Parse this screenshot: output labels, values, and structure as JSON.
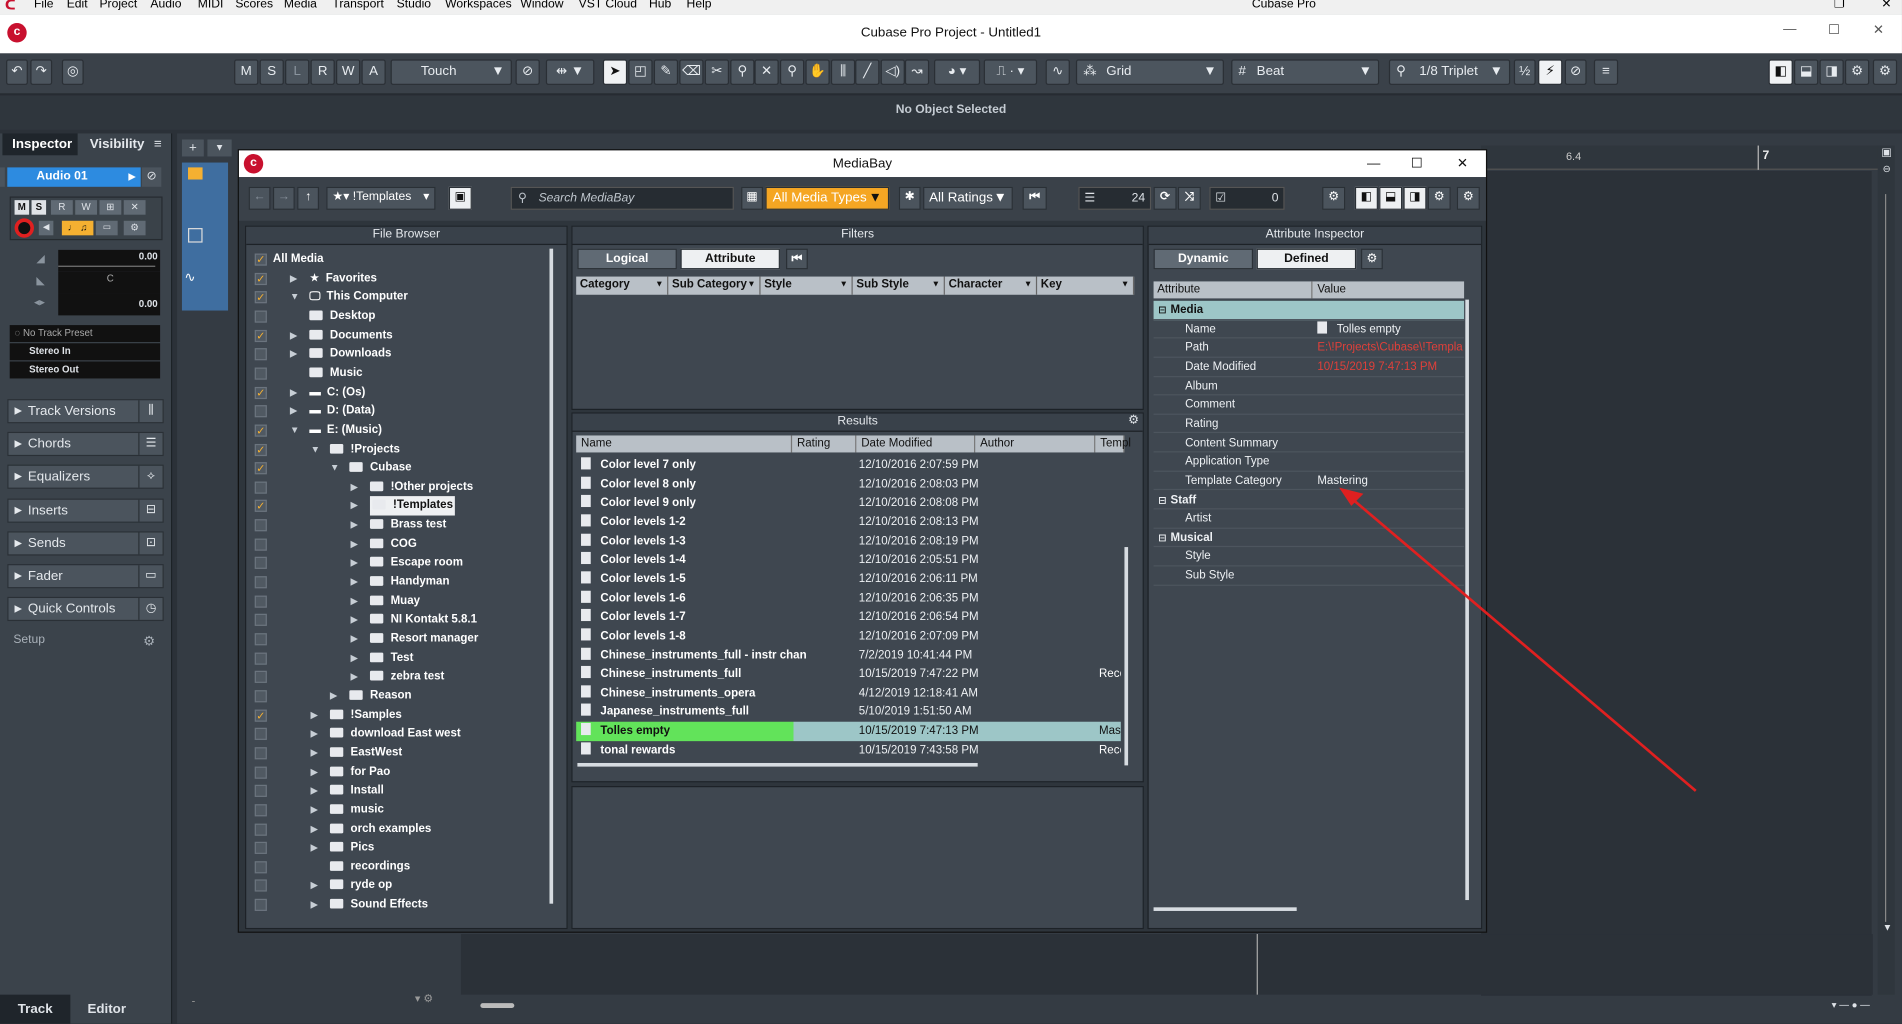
{
  "menu": {
    "items": [
      "File",
      "Edit",
      "Project",
      "Audio",
      "MIDI",
      "Scores",
      "Media",
      "Transport",
      "Studio",
      "Workspaces",
      "Window",
      "VST Cloud",
      "Hub",
      "Help"
    ],
    "app_name": "Cubase Pro"
  },
  "window": {
    "title": "Cubase Pro Project - Untitled1"
  },
  "toolbar": {
    "m": "M",
    "s": "S",
    "l": "L",
    "r": "R",
    "w": "W",
    "a": "A",
    "automation_mode": "Touch",
    "snap_type": "Grid",
    "grid_type": "Beat",
    "quantize": "1/8 Triplet"
  },
  "status": {
    "text": "No Object Selected"
  },
  "inspector": {
    "tab_inspector": "Inspector",
    "tab_visibility": "Visibility",
    "track_name": "Audio 01",
    "volume": "0.00",
    "pan": "C",
    "delay": "0.00",
    "track_preset": "No Track Preset",
    "input": "Stereo In",
    "output": "Stereo Out",
    "sections": [
      "Track Versions",
      "Chords",
      "Equalizers",
      "Inserts",
      "Sends",
      "Fader",
      "Quick Controls"
    ],
    "setup": "Setup",
    "bottom_track": "Track",
    "bottom_editor": "Editor"
  },
  "ruler": {
    "mark1": "6.4",
    "mark2": "7"
  },
  "mediabay": {
    "title": "MediaBay",
    "location": "!Templates",
    "search_placeholder": "Search MediaBay",
    "media_types": "All Media Types",
    "ratings": "All Ratings",
    "result_count": "24",
    "selected_count": "0",
    "file_browser": {
      "title": "File Browser",
      "items": [
        {
          "label": "All Media",
          "level": 0,
          "checked": true,
          "tri": "",
          "icon": ""
        },
        {
          "label": "Favorites",
          "level": 1,
          "checked": true,
          "tri": "▶",
          "icon": "star"
        },
        {
          "label": "This Computer",
          "level": 1,
          "checked": true,
          "tri": "▼",
          "icon": "pc"
        },
        {
          "label": "Desktop",
          "level": 2,
          "checked": false,
          "tri": "",
          "icon": "folder"
        },
        {
          "label": "Documents",
          "level": 2,
          "checked": true,
          "tri": "▶",
          "icon": "folder"
        },
        {
          "label": "Downloads",
          "level": 2,
          "checked": false,
          "tri": "▶",
          "icon": "folder"
        },
        {
          "label": "Music",
          "level": 2,
          "checked": false,
          "tri": "",
          "icon": "folder"
        },
        {
          "label": "C: (Os)",
          "level": 2,
          "checked": true,
          "tri": "▶",
          "icon": "drive"
        },
        {
          "label": "D: (Data)",
          "level": 2,
          "checked": false,
          "tri": "▶",
          "icon": "drive"
        },
        {
          "label": "E: (Music)",
          "level": 2,
          "checked": true,
          "tri": "▼",
          "icon": "drive"
        },
        {
          "label": "!Projects",
          "level": 3,
          "checked": true,
          "tri": "▼",
          "icon": "folder"
        },
        {
          "label": "Cubase",
          "level": 4,
          "checked": true,
          "tri": "▼",
          "icon": "folder"
        },
        {
          "label": "!Other projects",
          "level": 5,
          "checked": false,
          "tri": "▶",
          "icon": "folder"
        },
        {
          "label": "!Templates",
          "level": 5,
          "checked": true,
          "tri": "▶",
          "icon": "folder",
          "selected": true
        },
        {
          "label": "Brass test",
          "level": 5,
          "checked": false,
          "tri": "▶",
          "icon": "folder"
        },
        {
          "label": "COG",
          "level": 5,
          "checked": false,
          "tri": "▶",
          "icon": "folder"
        },
        {
          "label": "Escape room",
          "level": 5,
          "checked": false,
          "tri": "▶",
          "icon": "folder"
        },
        {
          "label": "Handyman",
          "level": 5,
          "checked": false,
          "tri": "▶",
          "icon": "folder"
        },
        {
          "label": "Muay",
          "level": 5,
          "checked": false,
          "tri": "▶",
          "icon": "folder"
        },
        {
          "label": "NI Kontakt 5.8.1",
          "level": 5,
          "checked": false,
          "tri": "▶",
          "icon": "folder"
        },
        {
          "label": "Resort manager",
          "level": 5,
          "checked": false,
          "tri": "▶",
          "icon": "folder"
        },
        {
          "label": "Test",
          "level": 5,
          "checked": false,
          "tri": "▶",
          "icon": "folder"
        },
        {
          "label": "zebra test",
          "level": 5,
          "checked": false,
          "tri": "▶",
          "icon": "folder"
        },
        {
          "label": "Reason",
          "level": 4,
          "checked": false,
          "tri": "▶",
          "icon": "folder"
        },
        {
          "label": "!Samples",
          "level": 3,
          "checked": true,
          "tri": "▶",
          "icon": "folder"
        },
        {
          "label": "download East west",
          "level": 3,
          "checked": false,
          "tri": "▶",
          "icon": "folder"
        },
        {
          "label": "EastWest",
          "level": 3,
          "checked": false,
          "tri": "▶",
          "icon": "folder"
        },
        {
          "label": "for Pao",
          "level": 3,
          "checked": false,
          "tri": "▶",
          "icon": "folder"
        },
        {
          "label": "Install",
          "level": 3,
          "checked": false,
          "tri": "▶",
          "icon": "folder"
        },
        {
          "label": "music",
          "level": 3,
          "checked": false,
          "tri": "▶",
          "icon": "folder"
        },
        {
          "label": "orch examples",
          "level": 3,
          "checked": false,
          "tri": "▶",
          "icon": "folder"
        },
        {
          "label": "Pics",
          "level": 3,
          "checked": false,
          "tri": "▶",
          "icon": "folder"
        },
        {
          "label": "recordings",
          "level": 3,
          "checked": false,
          "tri": "",
          "icon": "folder"
        },
        {
          "label": "ryde op",
          "level": 3,
          "checked": false,
          "tri": "▶",
          "icon": "folder"
        },
        {
          "label": "Sound Effects",
          "level": 3,
          "checked": false,
          "tri": "▶",
          "icon": "folder"
        }
      ]
    },
    "filters": {
      "title": "Filters",
      "logical": "Logical",
      "attribute": "Attribute",
      "columns": [
        "Category",
        "Sub Category",
        "Style",
        "Sub Style",
        "Character",
        "Key"
      ]
    },
    "results": {
      "title": "Results",
      "columns": [
        "Name",
        "Rating",
        "Date Modified",
        "Author",
        "Templ"
      ],
      "rows": [
        {
          "name": "Color level 7 only",
          "date": "12/10/2016 2:07:59 PM",
          "tpl": ""
        },
        {
          "name": "Color level 8 only",
          "date": "12/10/2016 2:08:03 PM",
          "tpl": ""
        },
        {
          "name": "Color level 9 only",
          "date": "12/10/2016 2:08:08 PM",
          "tpl": ""
        },
        {
          "name": "Color levels 1-2",
          "date": "12/10/2016 2:08:13 PM",
          "tpl": ""
        },
        {
          "name": "Color levels 1-3",
          "date": "12/10/2016 2:08:19 PM",
          "tpl": ""
        },
        {
          "name": "Color levels 1-4",
          "date": "12/10/2016 2:05:51 PM",
          "tpl": ""
        },
        {
          "name": "Color levels 1-5",
          "date": "12/10/2016 2:06:11 PM",
          "tpl": ""
        },
        {
          "name": "Color levels 1-6",
          "date": "12/10/2016 2:06:35 PM",
          "tpl": ""
        },
        {
          "name": "Color levels 1-7",
          "date": "12/10/2016 2:06:54 PM",
          "tpl": ""
        },
        {
          "name": "Color levels 1-8",
          "date": "12/10/2016 2:07:09 PM",
          "tpl": ""
        },
        {
          "name": "Chinese_instruments_full - instr chan",
          "date": "7/2/2019 10:41:44 PM",
          "tpl": ""
        },
        {
          "name": "Chinese_instruments_full",
          "date": "10/15/2019 7:47:22 PM",
          "tpl": "Recc"
        },
        {
          "name": "Chinese_instruments_opera",
          "date": "4/12/2019 12:18:41 AM",
          "tpl": ""
        },
        {
          "name": "Japanese_instruments_full",
          "date": "5/10/2019 1:51:50 AM",
          "tpl": ""
        },
        {
          "name": "Tolles empty",
          "date": "10/15/2019 7:47:13 PM",
          "tpl": "Mast",
          "selected": true
        },
        {
          "name": "tonal rewards",
          "date": "10/15/2019 7:43:58 PM",
          "tpl": "Recc"
        }
      ]
    },
    "attribute_inspector": {
      "title": "Attribute Inspector",
      "dynamic": "Dynamic",
      "defined": "Defined",
      "col_attribute": "Attribute",
      "col_value": "Value",
      "rows": [
        {
          "key": "Media",
          "value": "",
          "group": true
        },
        {
          "key": "Name",
          "value": "Tolles empty",
          "doc": true
        },
        {
          "key": "Path",
          "value": "E:\\!Projects\\Cubase\\!Template",
          "red": true
        },
        {
          "key": "Date Modified",
          "value": "10/15/2019 7:47:13 PM",
          "red": true
        },
        {
          "key": "Album",
          "value": ""
        },
        {
          "key": "Comment",
          "value": ""
        },
        {
          "key": "Rating",
          "value": ""
        },
        {
          "key": "Content Summary",
          "value": ""
        },
        {
          "key": "Application Type",
          "value": ""
        },
        {
          "key": "Template Category",
          "value": "Mastering"
        },
        {
          "key": "Staff",
          "value": "",
          "group2": true
        },
        {
          "key": "Artist",
          "value": ""
        },
        {
          "key": "Musical",
          "value": "",
          "group2": true
        },
        {
          "key": "Style",
          "value": ""
        },
        {
          "key": "Sub Style",
          "value": ""
        }
      ]
    }
  },
  "colors": {
    "accent_orange": "#f5a623",
    "selection_green": "#62e35a",
    "arrow_red": "#e02020",
    "cubase_red": "#c8102e"
  }
}
